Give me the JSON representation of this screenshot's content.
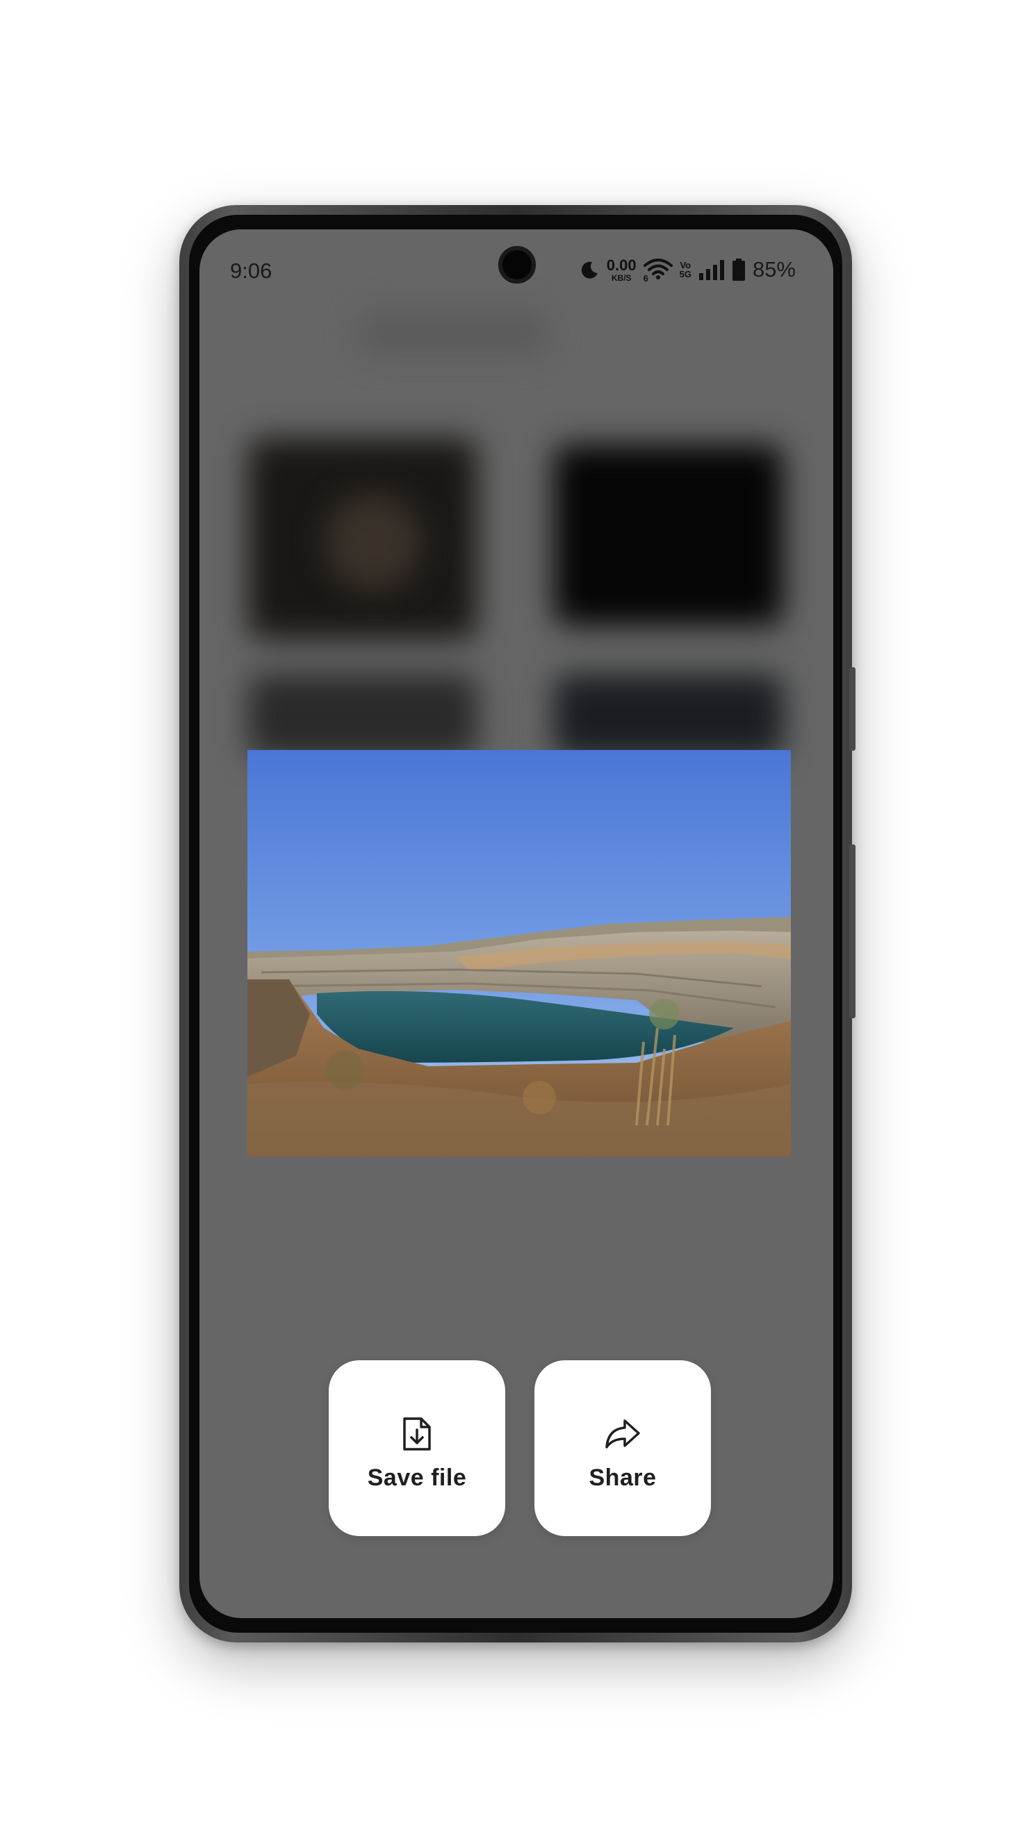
{
  "status_bar": {
    "time": "9:06",
    "net_speed_value": "0.00",
    "net_speed_unit": "KB/S",
    "wifi_label": "6",
    "volte_top": "Vo",
    "volte_bottom": "5G",
    "battery_percent": "85%",
    "icons": [
      "dnd-moon-icon",
      "wifi-icon",
      "signal-bars-icon",
      "battery-icon"
    ]
  },
  "preview": {
    "subject": "landscape-photo-thumbnail"
  },
  "actions": {
    "save": {
      "label": "Save file",
      "icon": "file-download-icon"
    },
    "share": {
      "label": "Share",
      "icon": "share-arrow-icon"
    }
  },
  "colors": {
    "screen_dim": "#666666",
    "button_bg": "#ffffff",
    "label_text": "#1f1f1f"
  }
}
